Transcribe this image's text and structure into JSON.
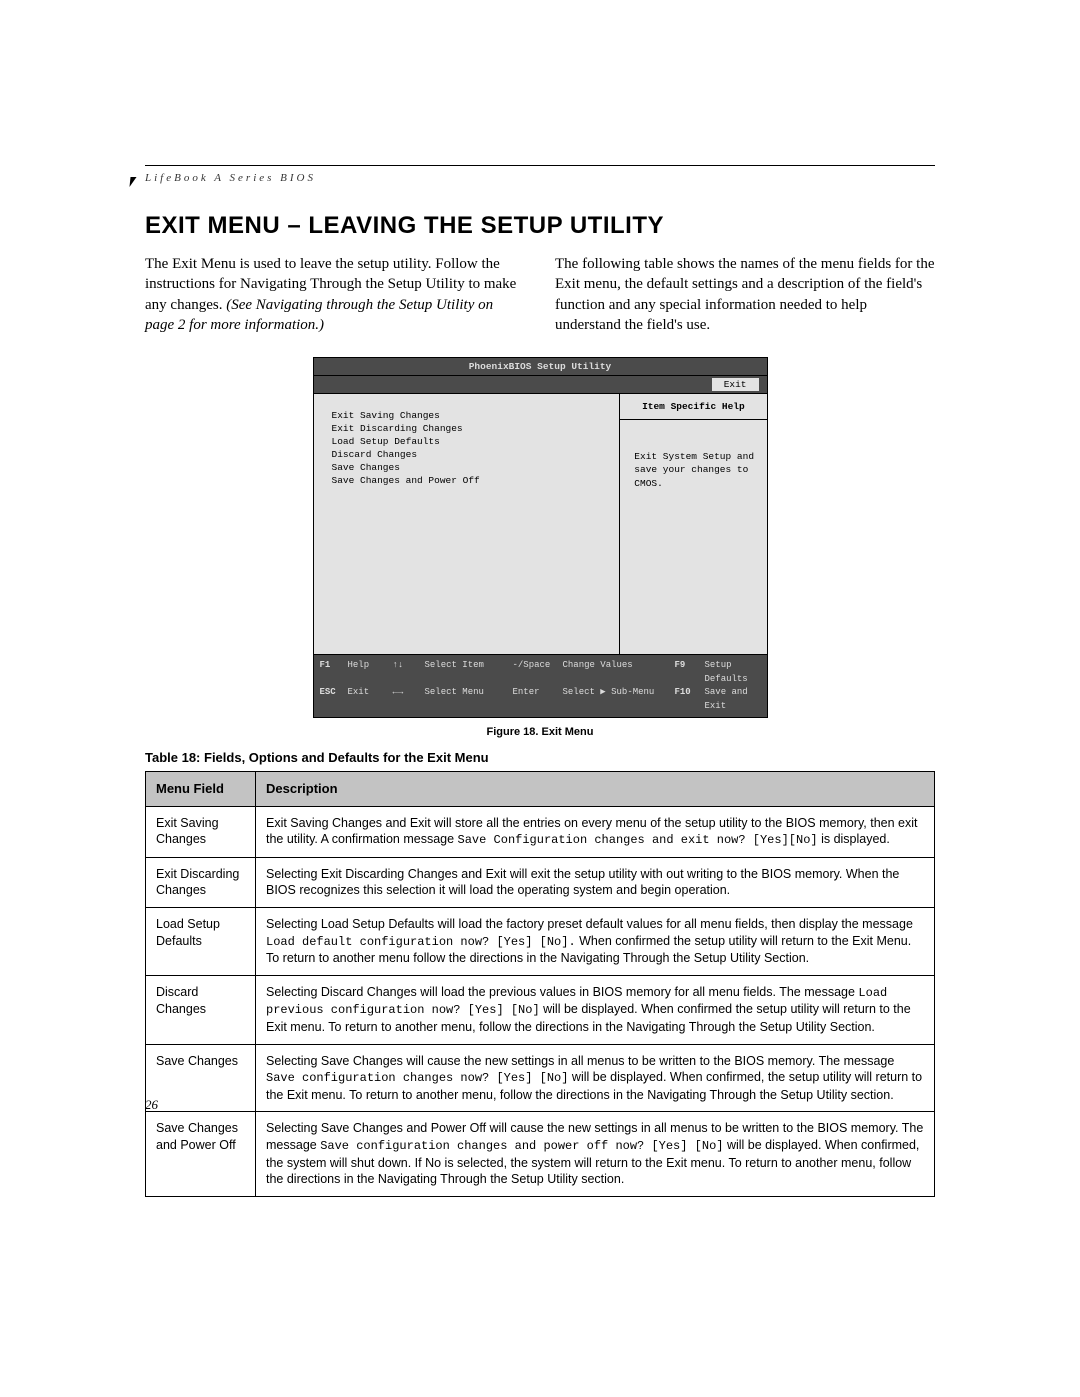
{
  "running_head": "LifeBook A Series BIOS",
  "title": "EXIT MENU – LEAVING THE SETUP UTILITY",
  "intro_col1_a": "The Exit Menu is used to leave the setup utility. Follow the instructions for Navigating Through the Setup Utility to make any changes. ",
  "intro_col1_b": "(See Navigating through the Setup Utility on page 2 for more information.)",
  "intro_col2": "The following table shows the names of the menu fields for the Exit menu, the default settings and a description of the field's function and any special information needed to help understand the field's use.",
  "bios": {
    "title": "PhoenixBIOS Setup Utility",
    "tab": "Exit",
    "menu_items": [
      "Exit Saving Changes",
      "Exit Discarding Changes",
      "Load Setup Defaults",
      "Discard Changes",
      "Save Changes",
      "Save Changes and Power Off"
    ],
    "help_title": "Item Specific Help",
    "help_text": "Exit System Setup and save your changes to CMOS.",
    "footer": {
      "r1": {
        "k1": "F1",
        "l1": "Help",
        "a1": "↑↓",
        "al1": "Select Item",
        "c1": "-/Space",
        "cl1": "Change Values",
        "r1k": "F9",
        "r1l": "Setup Defaults"
      },
      "r2": {
        "k1": "ESC",
        "l1": "Exit",
        "a1": "←→",
        "al1": "Select Menu",
        "c1": "Enter",
        "cl1": "Select ▶ Sub-Menu",
        "r1k": "F10",
        "r1l": "Save and Exit"
      }
    }
  },
  "figure_caption": "Figure 18.  Exit Menu",
  "table_caption": "Table 18: Fields, Options and Defaults for the Exit Menu",
  "table_cols": {
    "c1": "Menu Field",
    "c2": "Description"
  },
  "rows": [
    {
      "field": "Exit Saving Changes",
      "desc_a": "Exit Saving Changes and Exit will store all the entries on every menu of the setup utility to the BIOS memory, then exit the utility. A confirmation message ",
      "desc_mono": "Save Configuration changes and exit now? [Yes][No]",
      "desc_b": " is displayed."
    },
    {
      "field": "Exit Discarding Changes",
      "desc_a": "Selecting Exit Discarding Changes and Exit will exit the setup utility with out writing to the BIOS memory. When the BIOS recognizes this selection it will load the operating system and begin operation.",
      "desc_mono": "",
      "desc_b": ""
    },
    {
      "field": "Load Setup Defaults",
      "desc_a": "Selecting Load Setup Defaults will load the factory preset default values for all menu fields, then display the message ",
      "desc_mono": "Load default configuration now? [Yes] [No].",
      "desc_b": " When confirmed the setup utility will return to the Exit Menu. To return to another menu follow the directions in the Navigating Through the Setup Utility Section."
    },
    {
      "field": "Discard Changes",
      "desc_a": "Selecting Discard Changes will load the previous values in BIOS memory for all menu fields. The message ",
      "desc_mono": "Load previous configuration now? [Yes] [No]",
      "desc_b": " will be displayed. When confirmed the setup utility will return to the Exit menu. To return to another menu, follow the directions in the Navigating Through the Setup Utility Section."
    },
    {
      "field": "Save Changes",
      "desc_a": "Selecting Save Changes will cause the new settings in all menus to be written to the BIOS memory. The message ",
      "desc_mono": "Save configuration changes now? [Yes] [No]",
      "desc_b": " will be displayed. When confirmed, the setup utility will return to the Exit menu. To return to another menu, follow the directions in the Navigating Through the Setup Utility section."
    },
    {
      "field": "Save Changes and Power Off",
      "desc_a": "Selecting Save Changes and Power Off will cause the new settings in all menus to be written to the BIOS memory. The message ",
      "desc_mono": "Save configuration changes and power off now? [Yes] [No]",
      "desc_b": " will be displayed. When confirmed, the system will shut down. If No is selected, the system will return to the Exit menu. To return to another menu, follow the directions in the Navigating Through the Setup Utility section."
    }
  ],
  "page_number": "26"
}
